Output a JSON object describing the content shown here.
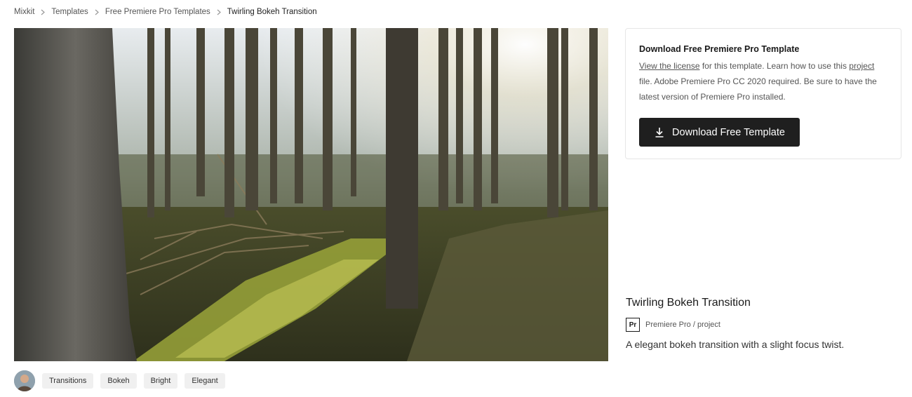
{
  "breadcrumb": {
    "items": [
      "Mixkit",
      "Templates",
      "Free Premiere Pro Templates",
      "Twirling Bokeh Transition"
    ]
  },
  "download_card": {
    "title": "Download Free Premiere Pro Template",
    "license_link": "View the license",
    "text_after_license": " for this template. Learn how to use this ",
    "project_link": "project",
    "text_after_project": " file. Adobe Premiere Pro CC 2020 required. Be sure to have the latest version of Premiere Pro installed.",
    "button_label": "Download Free Template"
  },
  "item": {
    "title": "Twirling Bokeh Transition",
    "badge": "Pr",
    "meta": "Premiere Pro / project",
    "description": "A elegant bokeh transition with a slight focus twist."
  },
  "tags": [
    "Transitions",
    "Bokeh",
    "Bright",
    "Elegant"
  ],
  "colors": {
    "button_bg": "#1f1f1f",
    "tag_bg": "#f0f0f0",
    "card_border": "#e6e6e6"
  },
  "icons": {
    "separator": "chevron-right-icon",
    "download": "download-icon"
  }
}
